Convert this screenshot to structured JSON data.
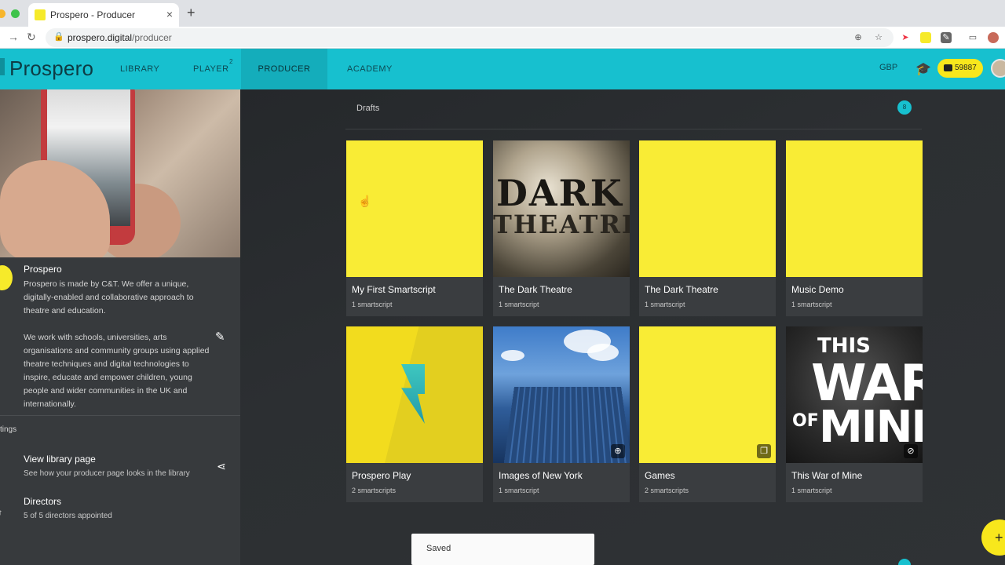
{
  "browser": {
    "tab_title": "Prospero - Producer",
    "tab_close": "×",
    "new_tab": "+",
    "url_domain": "prospero.digital",
    "url_path": "/producer"
  },
  "app": {
    "logo": "Prospero",
    "nav": [
      {
        "label": "LIBRARY"
      },
      {
        "label": "PLAYER",
        "badge": "2"
      },
      {
        "label": "PRODUCER"
      },
      {
        "label": "ACADEMY"
      }
    ],
    "currency": "GBP",
    "credits": "59887"
  },
  "profile": {
    "name": "Prospero",
    "description": "Prospero is made by C&T. We offer a unique, digitally-enabled and collaborative approach to theatre and education.\n\nWe work with schools, universities, arts organisations and community groups using applied theatre techniques and digital technologies to inspire, educate and empower children, young people and wider communities in the UK and internationally.",
    "settings_label": "tings",
    "view_library_title": "View library page",
    "view_library_sub": "See how your producer page looks in the library",
    "directors_title": "Directors",
    "directors_sub": "5 of 5 directors appointed"
  },
  "drafts": {
    "label": "Drafts",
    "count": "8",
    "cards": [
      {
        "title": "My First Smartscript",
        "sub": "1 smartscript",
        "thumb": "yellow"
      },
      {
        "title": "The Dark Theatre",
        "sub": "1 smartscript",
        "thumb": "dark-theatre"
      },
      {
        "title": "The Dark Theatre",
        "sub": "1 smartscript",
        "thumb": "yellow"
      },
      {
        "title": "Music Demo",
        "sub": "1 smartscript",
        "thumb": "yellow"
      },
      {
        "title": "Prospero Play",
        "sub": "2 smartscripts",
        "thumb": "prospero-play"
      },
      {
        "title": "Images of New York",
        "sub": "1 smartscript",
        "thumb": "new-york",
        "icon": "globe-icon"
      },
      {
        "title": "Games",
        "sub": "2 smartscripts",
        "thumb": "yellow",
        "icon": "copy-icon"
      },
      {
        "title": "This War of Mine",
        "sub": "1 smartscript",
        "thumb": "war-of-mine",
        "icon": "eye-off-icon"
      }
    ],
    "dark_theatre_art": {
      "line1": "DARK",
      "line2": "THEATRE"
    },
    "war_art": {
      "line1": "THIS",
      "line2": "WAR",
      "line3": "OF",
      "line4": "MINE"
    }
  },
  "snackbar": {
    "text": "Saved"
  },
  "fab": {
    "label": "+"
  },
  "colors": {
    "accent": "#17c0cf",
    "yellow": "#f9ec35",
    "panel": "#373a3d",
    "background": "#2b2e31"
  }
}
